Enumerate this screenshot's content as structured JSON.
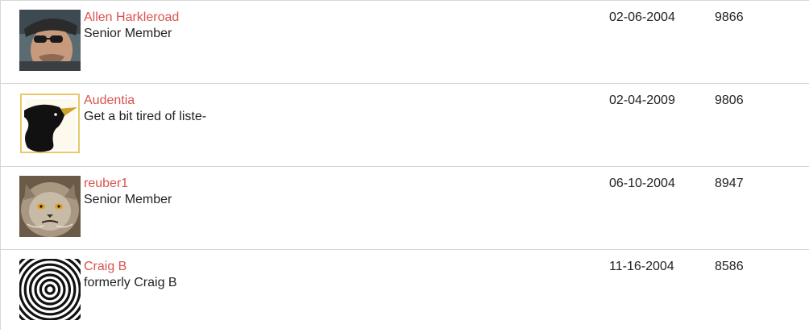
{
  "members": [
    {
      "name": "Allen Harkleroad",
      "title": "Senior Member",
      "joined": "02-06-2004",
      "posts": "9866",
      "avatar_icon": "man-with-sunglasses-photo"
    },
    {
      "name": "Audentia",
      "title": "Get a bit tired of liste-",
      "joined": "02-04-2009",
      "posts": "9806",
      "avatar_icon": "black-unicorn-logo"
    },
    {
      "name": "reuber1",
      "title": "Senior Member",
      "joined": "06-10-2004",
      "posts": "8947",
      "avatar_icon": "grumpy-cat-photo"
    },
    {
      "name": "Craig B",
      "title": "formerly Craig B",
      "joined": "11-16-2004",
      "posts": "8586",
      "avatar_icon": "concentric-circles-graphic"
    }
  ],
  "colors": {
    "link": "#d9534f",
    "text": "#222222",
    "divider": "#d6d6d6"
  }
}
